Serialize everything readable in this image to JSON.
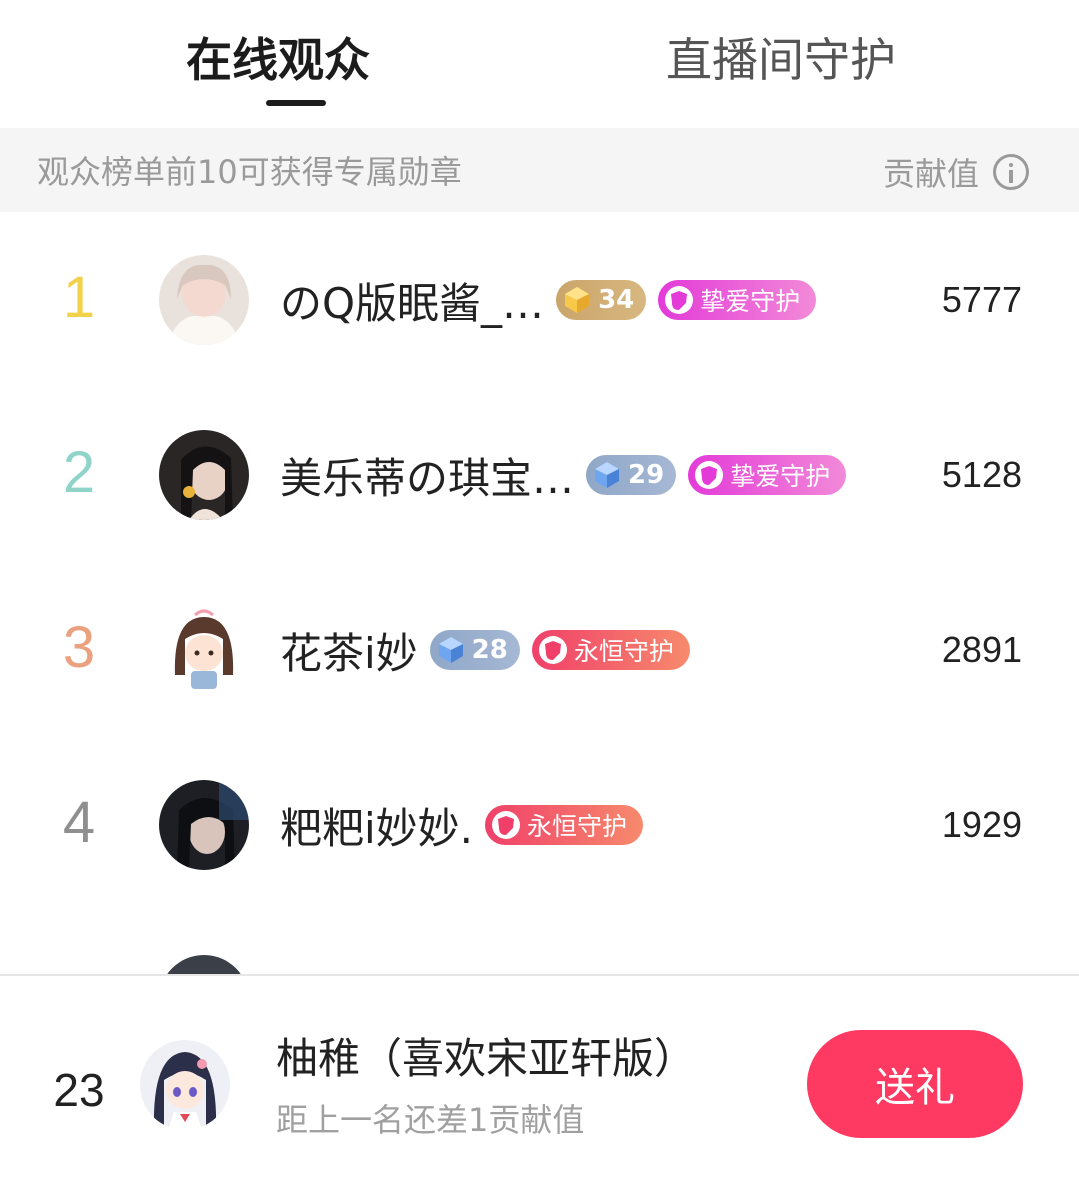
{
  "tabs": [
    {
      "label": "在线观众",
      "active": true
    },
    {
      "label": "直播间守护",
      "active": false
    }
  ],
  "info_bar": {
    "text": "观众榜单前10可获得专属勋章",
    "right_label": "贡献值",
    "icon": "info-icon"
  },
  "colors": {
    "rank1": "#f2d24a",
    "rank2": "#8fd3c9",
    "rank3": "#eba07e",
    "rank_default": "#8f8f8f",
    "accent": "#fe3a62"
  },
  "rows": [
    {
      "rank": "1",
      "name": "のQ版眠酱_…",
      "level": "34",
      "level_style": "gold",
      "guard": "挚爱守护",
      "guard_style": "pink",
      "value": "5777"
    },
    {
      "rank": "2",
      "name": "美乐蒂の琪宝…",
      "level": "29",
      "level_style": "blue",
      "guard": "挚爱守护",
      "guard_style": "pink",
      "value": "5128"
    },
    {
      "rank": "3",
      "name": "花茶i妙",
      "level": "28",
      "level_style": "blue",
      "guard": "永恒守护",
      "guard_style": "red",
      "value": "2891"
    },
    {
      "rank": "4",
      "name": "粑粑i妙妙.",
      "level": null,
      "level_style": null,
      "guard": "永恒守护",
      "guard_style": "red",
      "value": "1929"
    }
  ],
  "footer": {
    "my_rank": "23",
    "my_name": "柚稚（喜欢宋亚轩版）",
    "hint": "距上一名还差1贡献值",
    "gift_button": "送礼"
  }
}
